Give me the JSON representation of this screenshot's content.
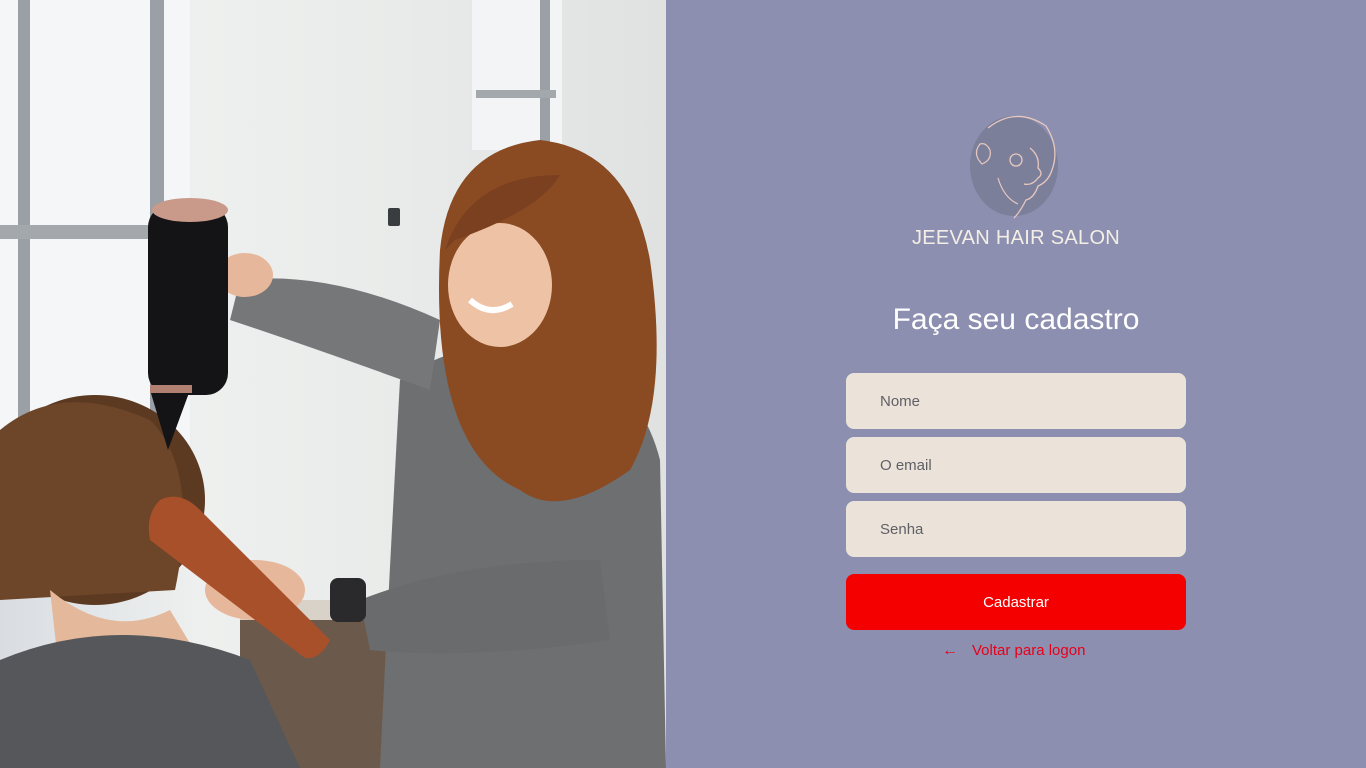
{
  "colors": {
    "panel_background": "#8c8faf",
    "input_background": "#ebe3d9",
    "button_background": "#f40000",
    "link_color": "#e8001a"
  },
  "brand": {
    "name": "JEEVAN HAIR SALON",
    "logo_icon": "salon-face-icon"
  },
  "form": {
    "title": "Faça seu cadastro",
    "fields": {
      "nome_placeholder": "Nome",
      "email_placeholder": "O email",
      "senha_placeholder": "Senha"
    },
    "submit_label": "Cadastrar",
    "back_link": {
      "icon": "arrow-left-icon",
      "label": "Voltar para logon"
    }
  },
  "hero_image": {
    "icon": "salon-photo"
  }
}
